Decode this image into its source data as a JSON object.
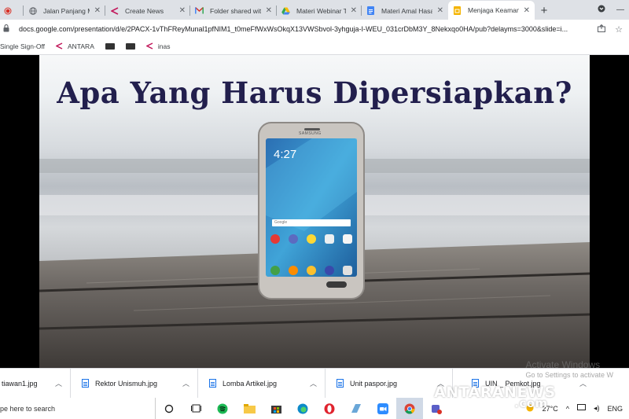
{
  "browser": {
    "tabs": [
      {
        "label": "",
        "icon": "record-icon",
        "active": false
      },
      {
        "label": "Jalan Panjang Me",
        "icon": "globe-icon",
        "active": false
      },
      {
        "label": "Create News",
        "icon": "antara-icon",
        "active": false
      },
      {
        "label": "Folder shared wit",
        "icon": "gmail-icon",
        "active": false
      },
      {
        "label": "Materi Webinar Ta",
        "icon": "drive-icon",
        "active": false
      },
      {
        "label": "Materi Amal Hasa",
        "icon": "docs-icon",
        "active": false
      },
      {
        "label": "Menjaga Keaman",
        "icon": "slides-icon",
        "active": true
      }
    ],
    "new_tab_symbol": "+",
    "url": "docs.google.com/presentation/d/e/2PACX-1vThFReyMunal1pfNIM1_t0meFfWxWsOkqX13VWSbvol-3yhguja-I-WEU_031crDbM3Y_8Nekxqo0HA/pub?delayms=3000&slide=i..."
  },
  "bookmarks": [
    {
      "label": "Single Sign-Off",
      "icon": ""
    },
    {
      "label": "ANTARA",
      "icon": "antara-icon"
    },
    {
      "label": "",
      "icon": "black-bookmark-icon"
    },
    {
      "label": "",
      "icon": "black-bookmark-icon"
    },
    {
      "label": "inas",
      "icon": "antara-icon"
    }
  ],
  "slide": {
    "title": "Apa Yang Harus Dipersiapkan?",
    "phone": {
      "time": "4:27",
      "brand": "SAMSUNG",
      "search_label": "Google",
      "apps_row1": [
        "Email",
        "Camera",
        "Gallery",
        "Play Store",
        "Google"
      ],
      "apps_row2": [
        "Phone",
        "Contacts",
        "Messages",
        "Internet",
        "Apps"
      ]
    }
  },
  "downloads": [
    {
      "label": "tiawan1.jpg"
    },
    {
      "label": "Rektor Unismuh.jpg"
    },
    {
      "label": "Lomba Artikel.jpg"
    },
    {
      "label": "Unit paspor.jpg"
    },
    {
      "label": "UIN _ Pemkot.jpg"
    }
  ],
  "watermark": {
    "line1": "Activate Windows",
    "line2": "Go to Settings to activate W"
  },
  "taskbar": {
    "search_placeholder": "pe here to search",
    "temperature": "27°C",
    "language": "ENG"
  },
  "overlay_logo": {
    "brand": "ANTARANEWS",
    "suffix": ".com"
  },
  "colors": {
    "title": "#221f4d",
    "chrome_bg": "#dee1e6",
    "accent_blue": "#1a73e8"
  }
}
